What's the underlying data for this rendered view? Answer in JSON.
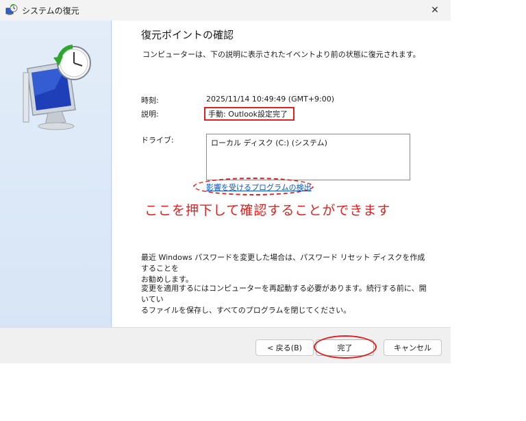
{
  "window": {
    "title": "システムの復元",
    "close_glyph": "✕"
  },
  "colors": {
    "annotation_red": "#e02020",
    "link_blue": "#0a55c8",
    "sidebar_bg": "#d7e5f6"
  },
  "main": {
    "title": "復元ポイントの確認",
    "subtitle": "コンピューターは、下の説明に表示されたイベントより前の状態に復元されます。",
    "time_label": "時刻:",
    "time_value": "2025/11/14 10:49:49 (GMT+9:00)",
    "description_label": "説明:",
    "description_value": "手動: Outlook設定完了",
    "drive_label": "ドライブ:",
    "drive_items": [
      "ローカル ディスク (C:) (システム)"
    ],
    "affected_programs_link": "影響を受けるプログラムの検出",
    "annotation_text": "ここを押下して確認することができます",
    "password_note_line1": "最近 Windows パスワードを変更した場合は、パスワード リセット ディスクを作成することを",
    "password_note_line2": "お勧めします。",
    "restart_note_line1": "変更を適用するにはコンピューターを再起動する必要があります。続行する前に、開いてい",
    "restart_note_line2": "るファイルを保存し、すべてのプログラムを閉じてください。"
  },
  "footer": {
    "back_label": "< 戻る(B)",
    "finish_label": "完了",
    "cancel_label": "キャンセル"
  }
}
